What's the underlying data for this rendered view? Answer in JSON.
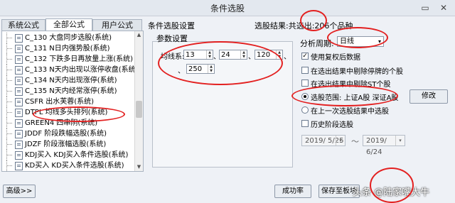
{
  "window": {
    "title": "条件选股",
    "minimize": "▭",
    "close": "✕"
  },
  "tabs": [
    {
      "label": "系统公式",
      "active": false
    },
    {
      "label": "全部公式",
      "active": true
    },
    {
      "label": "用户公式",
      "active": false
    }
  ],
  "formulas": [
    "C_130 大盘同步选股(系统)",
    "C_131 N日内强势股(系统)",
    "C_132 下跌多日再放量上涨(系统)",
    "C_133 N天内出现以涨停收盘(系统)",
    "C_134 N天内出现涨停(系统)",
    "C_135 N天内经常涨停(系统)",
    "CSFR 出水芙蓉(系统)",
    "DTPL 均线多头排列(系统)",
    "GREEN4 四串阴(系统)",
    "JDDF 阶段跌幅选股(系统)",
    "JDZF 阶段涨幅选股(系统)",
    "KDJ买入 KDJ买入条件选股(系统)",
    "KD买入 KD买入条件选股(系统)"
  ],
  "condition": {
    "title": "条件选股设置",
    "result": "选股结果:共选出:206个品种",
    "params_title": "参数设置",
    "ma_label": "均线系:",
    "ma_values": [
      "13",
      "24",
      "120",
      "250"
    ],
    "sep": "、"
  },
  "period": {
    "label": "分析周期:",
    "value": "日线"
  },
  "options": {
    "use_adj": {
      "label": "使用复权后数据",
      "checked": true
    },
    "exclude_suspended": {
      "label": "在选出结果中剔除停牌的个股",
      "checked": false
    },
    "exclude_st": {
      "label": "在选出结果中剔除ST个股",
      "checked": false
    },
    "range": {
      "label": "选股范围: 上证A股 深证A股",
      "selected": true
    },
    "prev_result": {
      "label": "在上一次选股结果中选股",
      "selected": false
    },
    "history": {
      "label": "历史阶段选股",
      "checked": false
    }
  },
  "modify_label": "修改",
  "dates": {
    "start": "2019/ 5/25",
    "end": "2019/ 6/24",
    "tilde": "～"
  },
  "buttons": {
    "advanced": "高级>>",
    "success_rate": "成功率",
    "save_block": "保存至板块"
  },
  "watermark": "头条 @陆家嘴大牛",
  "colors": {
    "annotation": "#e32020"
  },
  "icons": {
    "check": "✓",
    "dropdown": "▾",
    "spin_up": "▲",
    "spin_down": "▼",
    "scroll_up": "▲",
    "scroll_down": "▼"
  }
}
